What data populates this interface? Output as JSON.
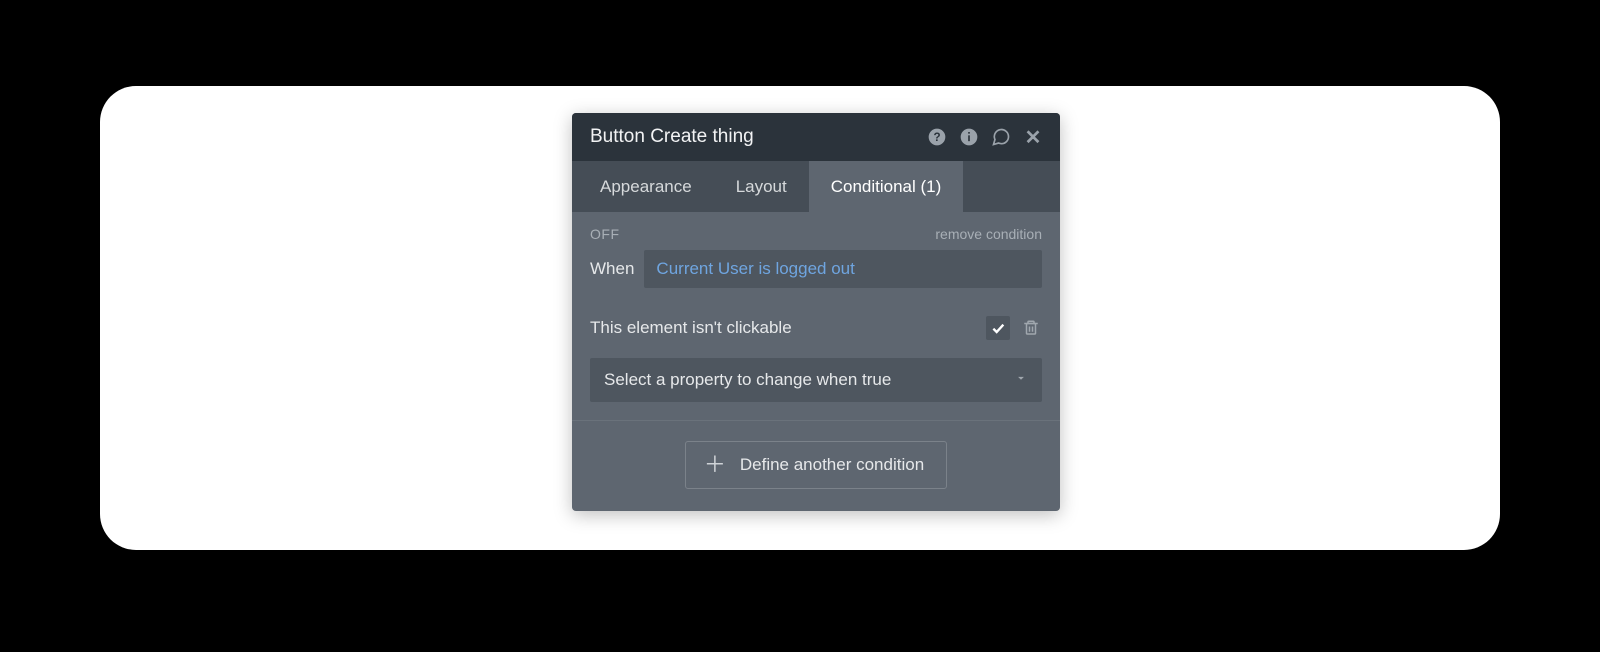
{
  "panel": {
    "title": "Button Create thing",
    "icons": {
      "help": "help-icon",
      "info": "info-icon",
      "comment": "speech-bubble-icon",
      "close": "close-icon"
    }
  },
  "tabs": [
    {
      "label": "Appearance",
      "active": false
    },
    {
      "label": "Layout",
      "active": false
    },
    {
      "label": "Conditional (1)",
      "active": true
    }
  ],
  "condition": {
    "status": "OFF",
    "remove_label": "remove condition",
    "when_label": "When",
    "expression": "Current User is logged out",
    "property_label": "This element isn't clickable",
    "property_checked": true,
    "select_placeholder": "Select a property to change when true"
  },
  "footer": {
    "define_label": "Define another condition"
  }
}
